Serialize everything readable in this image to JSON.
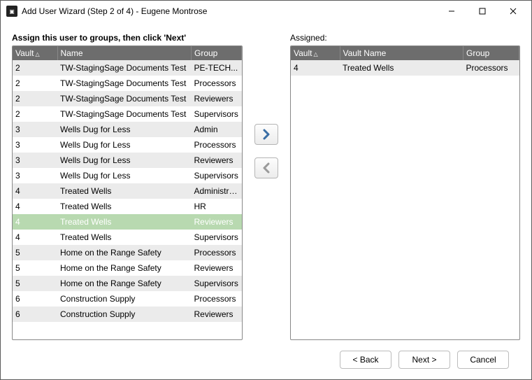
{
  "window": {
    "title": "Add User Wizard (Step 2 of 4) - Eugene Montrose"
  },
  "instructions": {
    "left": "Assign this user to groups, then click 'Next'",
    "right": "Assigned:"
  },
  "headers": {
    "left": {
      "vault": "Vault",
      "name": "Name",
      "group": "Group"
    },
    "right": {
      "vault": "Vault",
      "name": "Vault Name",
      "group": "Group"
    }
  },
  "available": [
    {
      "vault": "2",
      "name": "TW-StagingSage Documents Test",
      "group": "PE-TECH...",
      "sel": false
    },
    {
      "vault": "2",
      "name": "TW-StagingSage Documents Test",
      "group": "Processors",
      "sel": false
    },
    {
      "vault": "2",
      "name": "TW-StagingSage Documents Test",
      "group": "Reviewers",
      "sel": false
    },
    {
      "vault": "2",
      "name": "TW-StagingSage Documents Test",
      "group": "Supervisors",
      "sel": false
    },
    {
      "vault": "3",
      "name": "Wells Dug for Less",
      "group": "Admin",
      "sel": false
    },
    {
      "vault": "3",
      "name": "Wells Dug for Less",
      "group": "Processors",
      "sel": false
    },
    {
      "vault": "3",
      "name": "Wells Dug for Less",
      "group": "Reviewers",
      "sel": false
    },
    {
      "vault": "3",
      "name": "Wells Dug for Less",
      "group": "Supervisors",
      "sel": false
    },
    {
      "vault": "4",
      "name": "Treated Wells",
      "group": "Administrat...",
      "sel": false
    },
    {
      "vault": "4",
      "name": "Treated Wells",
      "group": "HR",
      "sel": false
    },
    {
      "vault": "4",
      "name": "Treated Wells",
      "group": "Reviewers",
      "sel": true
    },
    {
      "vault": "4",
      "name": "Treated Wells",
      "group": "Supervisors",
      "sel": false
    },
    {
      "vault": "5",
      "name": "Home on the Range Safety",
      "group": "Processors",
      "sel": false
    },
    {
      "vault": "5",
      "name": "Home on the Range Safety",
      "group": "Reviewers",
      "sel": false
    },
    {
      "vault": "5",
      "name": "Home on the Range Safety",
      "group": "Supervisors",
      "sel": false
    },
    {
      "vault": "6",
      "name": "Construction Supply",
      "group": "Processors",
      "sel": false
    },
    {
      "vault": "6",
      "name": "Construction Supply",
      "group": "Reviewers",
      "sel": false
    }
  ],
  "assigned": [
    {
      "vault": "4",
      "name": "Treated Wells",
      "group": "Processors"
    }
  ],
  "footer": {
    "back": "< Back",
    "next": "Next >",
    "cancel": "Cancel"
  }
}
